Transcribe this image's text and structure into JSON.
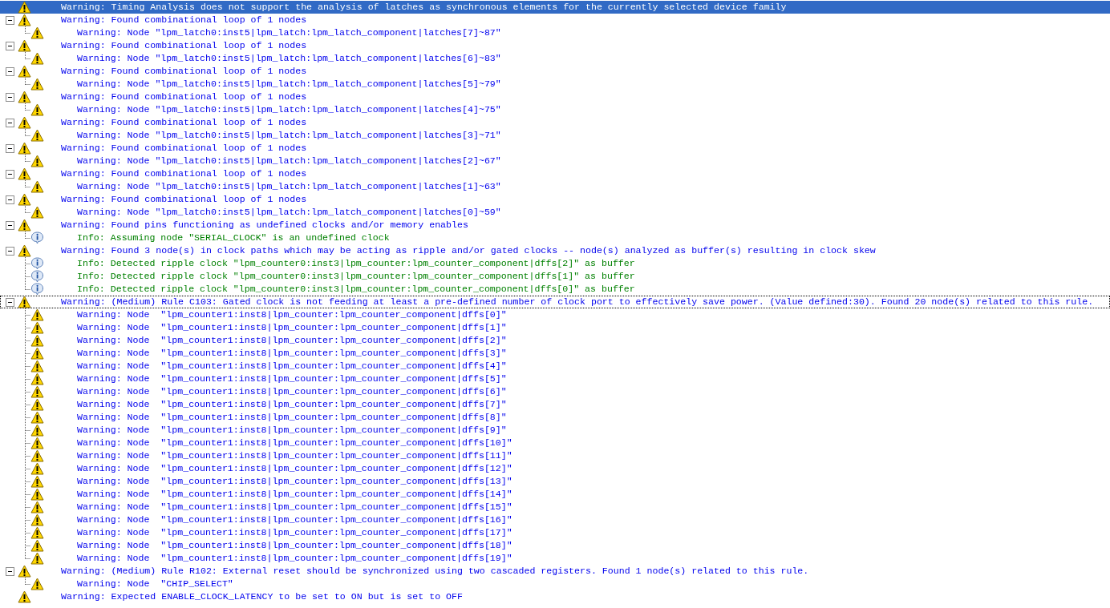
{
  "messages": [
    {
      "kind": "warning",
      "text": "Warning: Timing Analysis does not support the analysis of latches as synchronous elements for the currently selected device family",
      "selected": true,
      "focused": false
    },
    {
      "kind": "warning",
      "text": "Warning: Found combinational loop of 1 nodes",
      "selected": false,
      "focused": false,
      "expanded": true,
      "children": [
        {
          "kind": "warning",
          "text": "Warning: Node \"lpm_latch0:inst5|lpm_latch:lpm_latch_component|latches[7]~87\""
        }
      ]
    },
    {
      "kind": "warning",
      "text": "Warning: Found combinational loop of 1 nodes",
      "selected": false,
      "focused": false,
      "expanded": true,
      "children": [
        {
          "kind": "warning",
          "text": "Warning: Node \"lpm_latch0:inst5|lpm_latch:lpm_latch_component|latches[6]~83\""
        }
      ]
    },
    {
      "kind": "warning",
      "text": "Warning: Found combinational loop of 1 nodes",
      "selected": false,
      "focused": false,
      "expanded": true,
      "children": [
        {
          "kind": "warning",
          "text": "Warning: Node \"lpm_latch0:inst5|lpm_latch:lpm_latch_component|latches[5]~79\""
        }
      ]
    },
    {
      "kind": "warning",
      "text": "Warning: Found combinational loop of 1 nodes",
      "selected": false,
      "focused": false,
      "expanded": true,
      "children": [
        {
          "kind": "warning",
          "text": "Warning: Node \"lpm_latch0:inst5|lpm_latch:lpm_latch_component|latches[4]~75\""
        }
      ]
    },
    {
      "kind": "warning",
      "text": "Warning: Found combinational loop of 1 nodes",
      "selected": false,
      "focused": false,
      "expanded": true,
      "children": [
        {
          "kind": "warning",
          "text": "Warning: Node \"lpm_latch0:inst5|lpm_latch:lpm_latch_component|latches[3]~71\""
        }
      ]
    },
    {
      "kind": "warning",
      "text": "Warning: Found combinational loop of 1 nodes",
      "selected": false,
      "focused": false,
      "expanded": true,
      "children": [
        {
          "kind": "warning",
          "text": "Warning: Node \"lpm_latch0:inst5|lpm_latch:lpm_latch_component|latches[2]~67\""
        }
      ]
    },
    {
      "kind": "warning",
      "text": "Warning: Found combinational loop of 1 nodes",
      "selected": false,
      "focused": false,
      "expanded": true,
      "children": [
        {
          "kind": "warning",
          "text": "Warning: Node \"lpm_latch0:inst5|lpm_latch:lpm_latch_component|latches[1]~63\""
        }
      ]
    },
    {
      "kind": "warning",
      "text": "Warning: Found combinational loop of 1 nodes",
      "selected": false,
      "focused": false,
      "expanded": true,
      "children": [
        {
          "kind": "warning",
          "text": "Warning: Node \"lpm_latch0:inst5|lpm_latch:lpm_latch_component|latches[0]~59\""
        }
      ]
    },
    {
      "kind": "warning",
      "text": "Warning: Found pins functioning as undefined clocks and/or memory enables",
      "selected": false,
      "focused": false,
      "expanded": true,
      "children": [
        {
          "kind": "info",
          "text": "Info: Assuming node \"SERIAL_CLOCK\" is an undefined clock"
        }
      ]
    },
    {
      "kind": "warning",
      "text": "Warning: Found 3 node(s) in clock paths which may be acting as ripple and/or gated clocks -- node(s) analyzed as buffer(s) resulting in clock skew",
      "selected": false,
      "focused": false,
      "expanded": true,
      "children": [
        {
          "kind": "info",
          "text": "Info: Detected ripple clock \"lpm_counter0:inst3|lpm_counter:lpm_counter_component|dffs[2]\" as buffer"
        },
        {
          "kind": "info",
          "text": "Info: Detected ripple clock \"lpm_counter0:inst3|lpm_counter:lpm_counter_component|dffs[1]\" as buffer"
        },
        {
          "kind": "info",
          "text": "Info: Detected ripple clock \"lpm_counter0:inst3|lpm_counter:lpm_counter_component|dffs[0]\" as buffer"
        }
      ]
    },
    {
      "kind": "warning",
      "text": "Warning: (Medium) Rule C103: Gated clock is not feeding at least a pre-defined number of clock port to effectively save power. (Value defined:30). Found 20 node(s) related to this rule.",
      "selected": false,
      "focused": true,
      "expanded": true,
      "children": [
        {
          "kind": "warning",
          "text": "Warning: Node  \"lpm_counter1:inst8|lpm_counter:lpm_counter_component|dffs[0]\""
        },
        {
          "kind": "warning",
          "text": "Warning: Node  \"lpm_counter1:inst8|lpm_counter:lpm_counter_component|dffs[1]\""
        },
        {
          "kind": "warning",
          "text": "Warning: Node  \"lpm_counter1:inst8|lpm_counter:lpm_counter_component|dffs[2]\""
        },
        {
          "kind": "warning",
          "text": "Warning: Node  \"lpm_counter1:inst8|lpm_counter:lpm_counter_component|dffs[3]\""
        },
        {
          "kind": "warning",
          "text": "Warning: Node  \"lpm_counter1:inst8|lpm_counter:lpm_counter_component|dffs[4]\""
        },
        {
          "kind": "warning",
          "text": "Warning: Node  \"lpm_counter1:inst8|lpm_counter:lpm_counter_component|dffs[5]\""
        },
        {
          "kind": "warning",
          "text": "Warning: Node  \"lpm_counter1:inst8|lpm_counter:lpm_counter_component|dffs[6]\""
        },
        {
          "kind": "warning",
          "text": "Warning: Node  \"lpm_counter1:inst8|lpm_counter:lpm_counter_component|dffs[7]\""
        },
        {
          "kind": "warning",
          "text": "Warning: Node  \"lpm_counter1:inst8|lpm_counter:lpm_counter_component|dffs[8]\""
        },
        {
          "kind": "warning",
          "text": "Warning: Node  \"lpm_counter1:inst8|lpm_counter:lpm_counter_component|dffs[9]\""
        },
        {
          "kind": "warning",
          "text": "Warning: Node  \"lpm_counter1:inst8|lpm_counter:lpm_counter_component|dffs[10]\""
        },
        {
          "kind": "warning",
          "text": "Warning: Node  \"lpm_counter1:inst8|lpm_counter:lpm_counter_component|dffs[11]\""
        },
        {
          "kind": "warning",
          "text": "Warning: Node  \"lpm_counter1:inst8|lpm_counter:lpm_counter_component|dffs[12]\""
        },
        {
          "kind": "warning",
          "text": "Warning: Node  \"lpm_counter1:inst8|lpm_counter:lpm_counter_component|dffs[13]\""
        },
        {
          "kind": "warning",
          "text": "Warning: Node  \"lpm_counter1:inst8|lpm_counter:lpm_counter_component|dffs[14]\""
        },
        {
          "kind": "warning",
          "text": "Warning: Node  \"lpm_counter1:inst8|lpm_counter:lpm_counter_component|dffs[15]\""
        },
        {
          "kind": "warning",
          "text": "Warning: Node  \"lpm_counter1:inst8|lpm_counter:lpm_counter_component|dffs[16]\""
        },
        {
          "kind": "warning",
          "text": "Warning: Node  \"lpm_counter1:inst8|lpm_counter:lpm_counter_component|dffs[17]\""
        },
        {
          "kind": "warning",
          "text": "Warning: Node  \"lpm_counter1:inst8|lpm_counter:lpm_counter_component|dffs[18]\""
        },
        {
          "kind": "warning",
          "text": "Warning: Node  \"lpm_counter1:inst8|lpm_counter:lpm_counter_component|dffs[19]\""
        }
      ]
    },
    {
      "kind": "warning",
      "text": "Warning: (Medium) Rule R102: External reset should be synchronized using two cascaded registers. Found 1 node(s) related to this rule.",
      "selected": false,
      "focused": false,
      "expanded": true,
      "children": [
        {
          "kind": "warning",
          "text": "Warning: Node  \"CHIP_SELECT\""
        }
      ]
    },
    {
      "kind": "warning",
      "text": "Warning: Expected ENABLE_CLOCK_LATENCY to be set to ON but is set to OFF",
      "selected": false,
      "focused": false
    }
  ]
}
